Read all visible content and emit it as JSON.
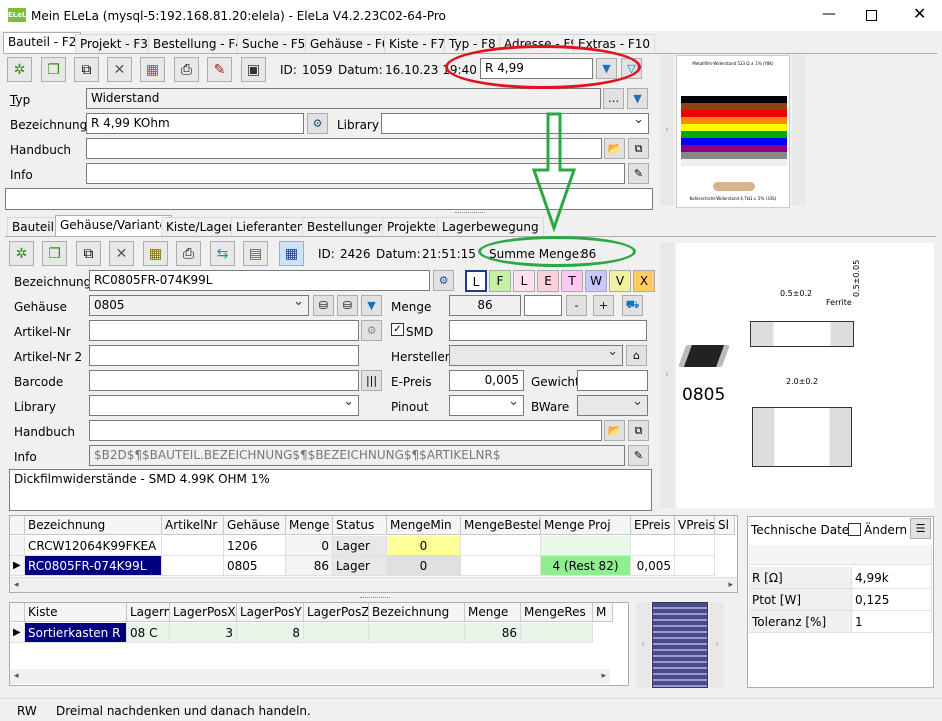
{
  "window": {
    "title": "Mein ELeLa (mysql-5:192.168.81.20:elela) - EleLa V4.2.23C02-64-Pro",
    "logo_text": "ELeLa"
  },
  "main_tabs": [
    "Bauteil - F2",
    "Projekt - F3",
    "Bestellung - F4",
    "Suche - F5",
    "Gehäuse - F6",
    "Kiste - F7",
    "Typ - F8",
    "Adresse - F9",
    "Extras - F10"
  ],
  "top": {
    "id_label": "ID:",
    "id_value": "1059",
    "datum_label": "Datum:",
    "datum_value": "16.10.23 19:40",
    "search_value": "R 4,99",
    "typ_label": "Typ",
    "typ_value": "Widerstand",
    "bez_label": "Bezeichnung",
    "bez_value": "R 4,99 KOhm",
    "library_label": "Library",
    "handbuch_label": "Handbuch",
    "info_label": "Info"
  },
  "thumbnail": {
    "title": "Metallfilm-Widerstand 523 Ω ± 1% (Y8K)",
    "caption": "Kohleschicht-Widerstand 4,7kΩ ± 5% (33S)"
  },
  "sub_tabs": [
    "Bauteil",
    "Gehäuse/Variante",
    "Kiste/Lager",
    "Lieferanten",
    "Bestellungen",
    "Projekte",
    "Lagerbewegung"
  ],
  "variant": {
    "id_label": "ID:",
    "id_value": "2426",
    "datum_label": "Datum:",
    "datum_value": "21:51:15",
    "summe_label": "Summe Menge:",
    "summe_value": "86",
    "bez_label": "Bezeichnung",
    "bez_value": "RC0805FR-074K99L",
    "gehaeuse_label": "Gehäuse",
    "gehaeuse_value": "0805",
    "menge_label": "Menge",
    "menge_value": "86",
    "artikel_label": "Artikel-Nr",
    "smd_label": "SMD",
    "artikel2_label": "Artikel-Nr 2",
    "hersteller_label": "Hersteller",
    "barcode_label": "Barcode",
    "epreis_label": "E-Preis",
    "epreis_value": "0,005",
    "gewicht_label": "Gewicht",
    "library_label": "Library",
    "pinout_label": "Pinout",
    "bware_label": "BWare",
    "handbuch_label": "Handbuch",
    "info_label": "Info",
    "info_value": "$B2D$¶$BAUTEIL.BEZEICHNUNG$¶$BEZEICHNUNG$¶$ARTIKELNR$",
    "memo": "Dickfilmwiderstände - SMD 4.99K OHM 1%",
    "letters": [
      "L",
      "F",
      "L",
      "E",
      "T",
      "W",
      "V",
      "X"
    ],
    "package_name": "0805"
  },
  "variant_grid": {
    "headers": [
      "Bezeichnung",
      "ArtikelNr",
      "Gehäuse",
      "Menge",
      "Status",
      "MengeMin",
      "MengeBestellt",
      "Menge Proj",
      "EPreis",
      "VPreis",
      "Sl"
    ],
    "rows": [
      [
        "CRCW12064K99FKEA",
        "",
        "1206",
        "0",
        "Lager",
        "0",
        "",
        "",
        "",
        ""
      ],
      [
        "RC0805FR-074K99L",
        "",
        "0805",
        "86",
        "Lager",
        "0",
        "",
        "4 (Rest 82)",
        "0,005",
        ""
      ]
    ]
  },
  "storage_grid": {
    "headers": [
      "Kiste",
      "Lagernr",
      "LagerPosX",
      "LagerPosY",
      "LagerPosZ",
      "Bezeichnung",
      "Menge",
      "MengeRes",
      "M"
    ],
    "rows": [
      [
        "Sortierkasten R",
        "08 C",
        "3",
        "8",
        "",
        "",
        "86",
        ""
      ]
    ]
  },
  "tech": {
    "title": "Technische Daten:",
    "change_label": "Ändern",
    "rows": [
      [
        "R [Ω]",
        "4,99k"
      ],
      [
        "Ptot [W]",
        "0,125"
      ],
      [
        "Toleranz [%]",
        "1"
      ]
    ]
  },
  "drawing": {
    "dim1": "0.5±0.2",
    "dim2": "Ferrite",
    "dim3": "0.5±0.05",
    "dim4": "2.0±0.2"
  },
  "status": {
    "mode": "RW",
    "message": "Dreimal nachdenken und danach handeln."
  },
  "colors": {
    "annotation_red": "#e0141e",
    "annotation_green": "#2aa845",
    "selection": "#000080",
    "green_cell": "#90ee90",
    "yellow_cell": "#ffff99"
  }
}
